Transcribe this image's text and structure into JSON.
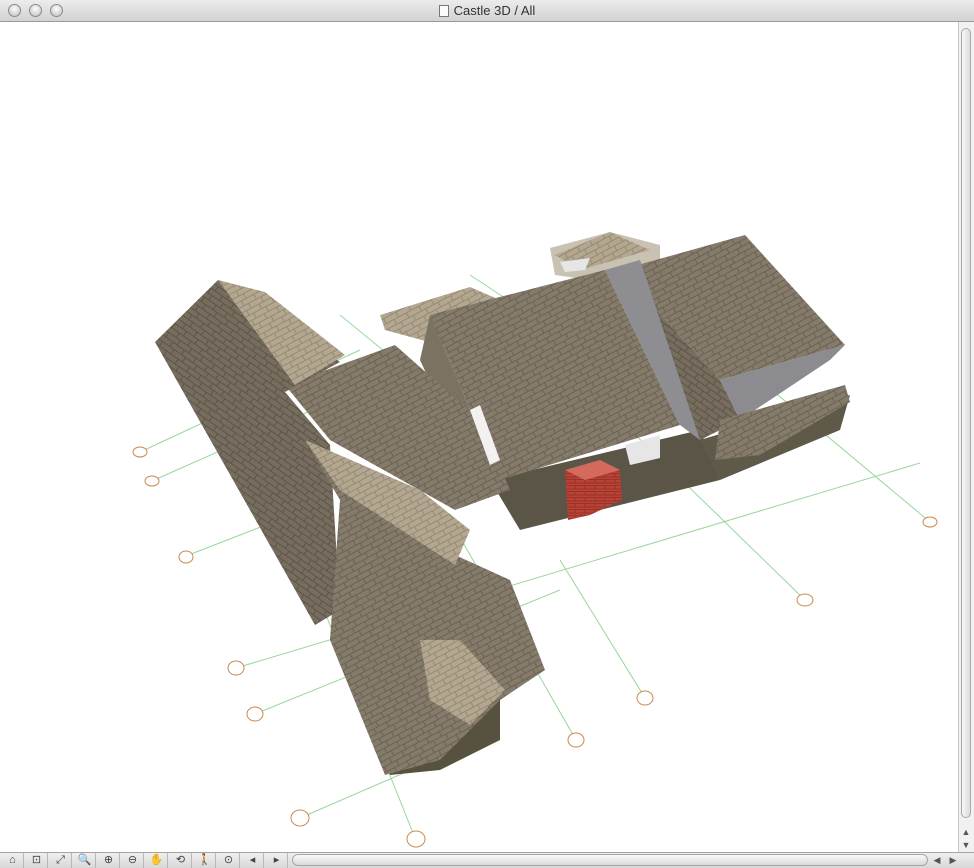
{
  "window": {
    "title": "Castle 3D / All"
  },
  "icons": {
    "close": "close-button",
    "minimize": "minimize-button",
    "zoom": "zoom-button",
    "document": "document-icon"
  },
  "toolbar": [
    {
      "name": "3d-view-icon",
      "glyph": "⌂"
    },
    {
      "name": "zoom-window-icon",
      "glyph": "⊡"
    },
    {
      "name": "fit-icon",
      "glyph": "⤢"
    },
    {
      "name": "zoom-step-icon",
      "glyph": "🔍"
    },
    {
      "name": "zoom-in-icon",
      "glyph": "⊕"
    },
    {
      "name": "zoom-out-icon",
      "glyph": "⊖"
    },
    {
      "name": "pan-icon",
      "glyph": "✋"
    },
    {
      "name": "orbit-icon",
      "glyph": "⟲"
    },
    {
      "name": "walk-icon",
      "glyph": "🚶"
    },
    {
      "name": "fit-in-window-icon",
      "glyph": "⊙"
    },
    {
      "name": "previous-zoom-icon",
      "glyph": "◂"
    },
    {
      "name": "next-zoom-icon",
      "glyph": "▸"
    }
  ],
  "colors": {
    "roof": "#8a8070",
    "roof_dark": "#6f6658",
    "roof_light": "#bfb39d",
    "wall": "#5a5546",
    "chimney": "#b23e32",
    "grid": "#8fd08f",
    "marker": "#c88a50"
  }
}
